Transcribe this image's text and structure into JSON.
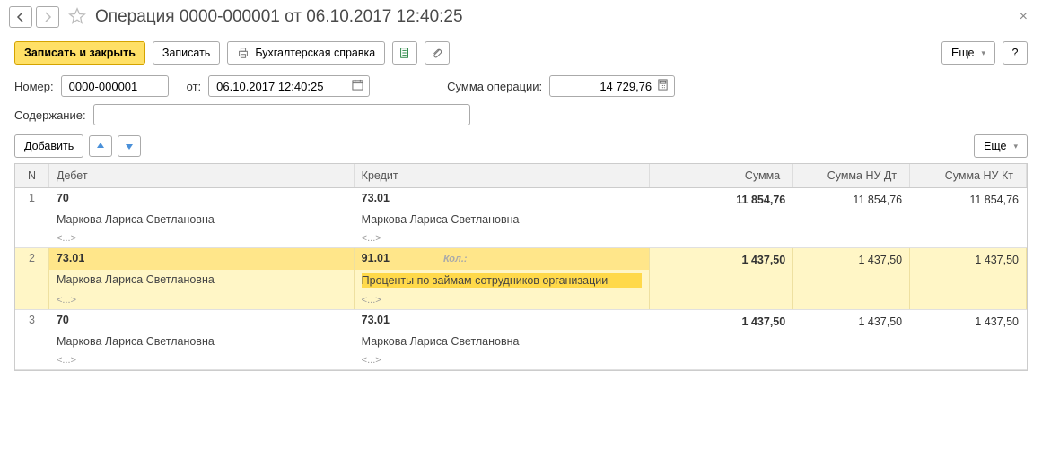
{
  "title": "Операция 0000-000001 от 06.10.2017 12:40:25",
  "toolbar": {
    "save_close": "Записать и закрыть",
    "save": "Записать",
    "acct_ref": "Бухгалтерская справка",
    "more": "Еще",
    "help": "?"
  },
  "form": {
    "number_label": "Номер:",
    "number_value": "0000-000001",
    "from_label": "от:",
    "date_value": "06.10.2017 12:40:25",
    "sum_label": "Сумма операции:",
    "sum_value": "14 729,76",
    "content_label": "Содержание:",
    "content_value": ""
  },
  "grid_toolbar": {
    "add": "Добавить",
    "more": "Еще"
  },
  "grid": {
    "headers": {
      "n": "N",
      "debit": "Дебет",
      "credit": "Кредит",
      "sum": "Сумма",
      "nudt": "Сумма НУ Дт",
      "nukt": "Сумма НУ Кт"
    },
    "kol_label": "Кол.:",
    "dots": "<...>",
    "rows": [
      {
        "n": "1",
        "debit_acc": "70",
        "debit_sub": "Маркова Лариса Светлановна",
        "credit_acc": "73.01",
        "credit_sub": "Маркова Лариса Светлановна",
        "sum": "11 854,76",
        "nudt": "11 854,76",
        "nukt": "11 854,76",
        "selected": false
      },
      {
        "n": "2",
        "debit_acc": "73.01",
        "debit_sub": "Маркова Лариса Светлановна",
        "credit_acc": "91.01",
        "credit_sub": "Проценты по займам сотрудников организации",
        "sum": "1 437,50",
        "nudt": "1 437,50",
        "nukt": "1 437,50",
        "selected": true,
        "show_kol": true
      },
      {
        "n": "3",
        "debit_acc": "70",
        "debit_sub": "Маркова Лариса Светлановна",
        "credit_acc": "73.01",
        "credit_sub": "Маркова Лариса Светлановна",
        "sum": "1 437,50",
        "nudt": "1 437,50",
        "nukt": "1 437,50",
        "selected": false
      }
    ]
  }
}
